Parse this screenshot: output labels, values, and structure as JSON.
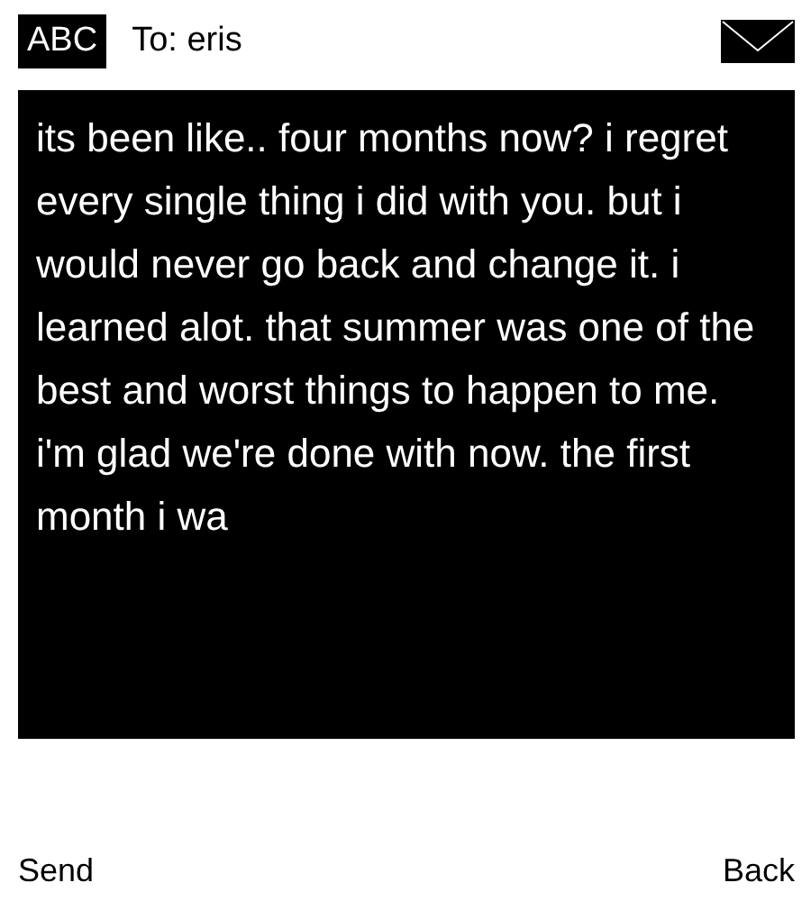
{
  "header": {
    "input_mode": "ABC",
    "recipient": "To: eris"
  },
  "message": {
    "value": "its been like.. four months now? i regret every single thing i did with you. but i would never go back and change it. i learned alot. that summer was one of the best and worst things to happen to me. i'm glad we're done with now. the first month i wa"
  },
  "softkeys": [
    {
      "label": "Send",
      "kind": "left"
    },
    {
      "label": "Back",
      "kind": "right"
    }
  ]
}
